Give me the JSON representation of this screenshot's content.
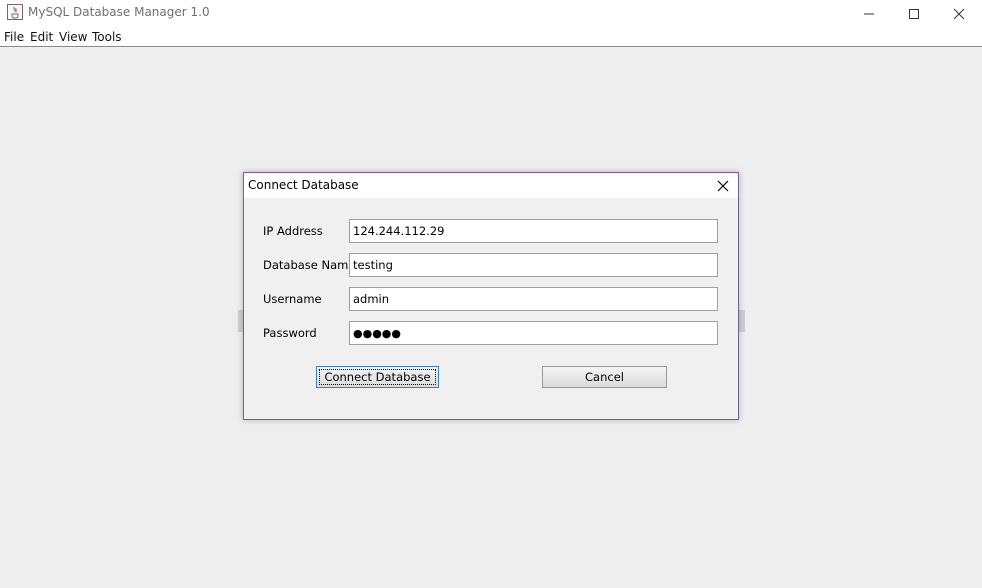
{
  "window": {
    "title": "MySQL Database Manager 1.0",
    "app_icon": "java-cup-icon",
    "controls": [
      "minimize-icon",
      "maximize-icon",
      "close-icon"
    ]
  },
  "menubar": {
    "items": [
      {
        "label": "File"
      },
      {
        "label": "Edit"
      },
      {
        "label": "View"
      },
      {
        "label": "Tools"
      }
    ]
  },
  "dialog": {
    "title": "Connect Database",
    "close_icon": "close-icon",
    "fields": [
      {
        "label": "IP Address",
        "value": "124.244.112.29"
      },
      {
        "label": "Database Name",
        "value": "testing"
      },
      {
        "label": "Username",
        "value": "admin"
      },
      {
        "label": "Password",
        "value": "●●●●●"
      }
    ],
    "buttons": {
      "connect": "Connect Database",
      "cancel": "Cancel"
    },
    "accent_color": "#7a5c9a"
  }
}
